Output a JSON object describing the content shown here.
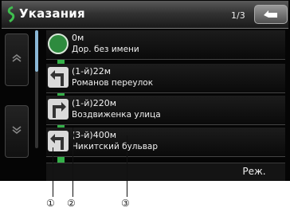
{
  "header": {
    "title": "Указания",
    "pager": "1/3"
  },
  "directions": [
    {
      "distance": "0м",
      "street": "Дор. без имени",
      "icon": "start-point-icon"
    },
    {
      "distance": "(1-й)22м",
      "street": "Романов переулок",
      "icon": "turn-left-icon"
    },
    {
      "distance": "(1-й)220м",
      "street": "Воздвиженка улица",
      "icon": "turn-right-icon"
    },
    {
      "distance": "(3-й)400м",
      "street": "Никитский бульвар",
      "icon": "turn-left-icon"
    }
  ],
  "footer": {
    "mode_label": "Реж."
  },
  "callouts": [
    "①",
    "②",
    "③"
  ],
  "colors": {
    "route": "#34b149",
    "header": "#3a3a3a",
    "background": "#050505"
  }
}
